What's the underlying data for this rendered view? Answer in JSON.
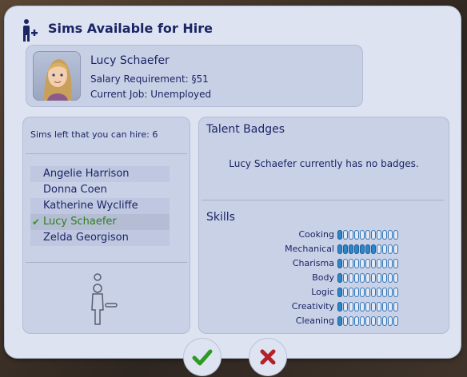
{
  "dialog": {
    "title": "Sims Available for Hire",
    "title_icon": "sim-add-icon"
  },
  "selected_sim": {
    "name": "Lucy Schaefer",
    "salary_text": "Salary Requirement: §51",
    "job_text": "Current Job: Unemployed",
    "portrait_icon": "sim-portrait"
  },
  "hire_list": {
    "remaining_text": "Sims left that you can hire:  6",
    "sims": [
      {
        "name": "Angelie Harrison",
        "selected": false
      },
      {
        "name": "Donna Coen",
        "selected": false
      },
      {
        "name": "Katherine Wycliffe",
        "selected": false
      },
      {
        "name": "Lucy Schaefer",
        "selected": true
      },
      {
        "name": "Zelda Georgison",
        "selected": false
      }
    ]
  },
  "talent_badges": {
    "title": "Talent Badges",
    "message": "Lucy Schaefer currently has no badges."
  },
  "skills": {
    "title": "Skills",
    "max_level": 11,
    "items": [
      {
        "label": "Cooking",
        "level": 1
      },
      {
        "label": "Mechanical",
        "level": 7
      },
      {
        "label": "Charisma",
        "level": 1
      },
      {
        "label": "Body",
        "level": 1
      },
      {
        "label": "Logic",
        "level": 1
      },
      {
        "label": "Creativity",
        "level": 1
      },
      {
        "label": "Cleaning",
        "level": 1
      }
    ]
  },
  "actions": {
    "accept_icon": "checkmark-icon",
    "cancel_icon": "x-icon",
    "accept_color": "#2e9a24",
    "cancel_color": "#b3202a"
  }
}
